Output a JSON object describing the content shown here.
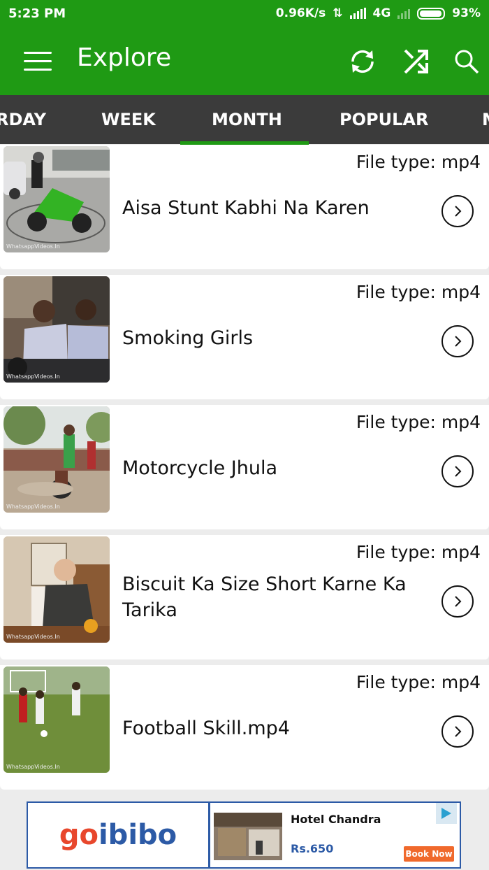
{
  "status_bar": {
    "time": "5:23 PM",
    "speed": "0.96K/s",
    "network": "4G",
    "battery": "93%"
  },
  "toolbar": {
    "title": "Explore",
    "icons": [
      "menu-icon",
      "refresh-icon",
      "shuffle-icon",
      "search-icon"
    ]
  },
  "tabs": [
    {
      "label": "RDAY"
    },
    {
      "label": "WEEK"
    },
    {
      "label": "MONTH",
      "selected": true
    },
    {
      "label": "POPULAR"
    },
    {
      "label": "M"
    }
  ],
  "videos": [
    {
      "file_type": "File type: mp4",
      "title": "Aisa Stunt Kabhi Na Karen",
      "watermark": "WhatsappVideos.In"
    },
    {
      "file_type": "File type: mp4",
      "title": "Smoking Girls",
      "watermark": "WhatsappVideos.In"
    },
    {
      "file_type": "File type: mp4",
      "title": "Motorcycle Jhula",
      "watermark": "WhatsappVideos.In"
    },
    {
      "file_type": "File type: mp4",
      "title": "Biscuit Ka Size Short Karne Ka Tarika",
      "watermark": "WhatsappVideos.In"
    },
    {
      "file_type": "File type: mp4",
      "title": "Football Skill.mp4",
      "watermark": "WhatsappVideos.In"
    }
  ],
  "ad": {
    "brand_go": "go",
    "brand_ibibo": "ibibo",
    "hotel_name": "Hotel Chandra",
    "price": "Rs.650",
    "cta": "Book Now"
  },
  "colors": {
    "app_bar": "#1f9a14",
    "tab_bar": "#3b3b3b",
    "indicator": "#1f9a14"
  }
}
